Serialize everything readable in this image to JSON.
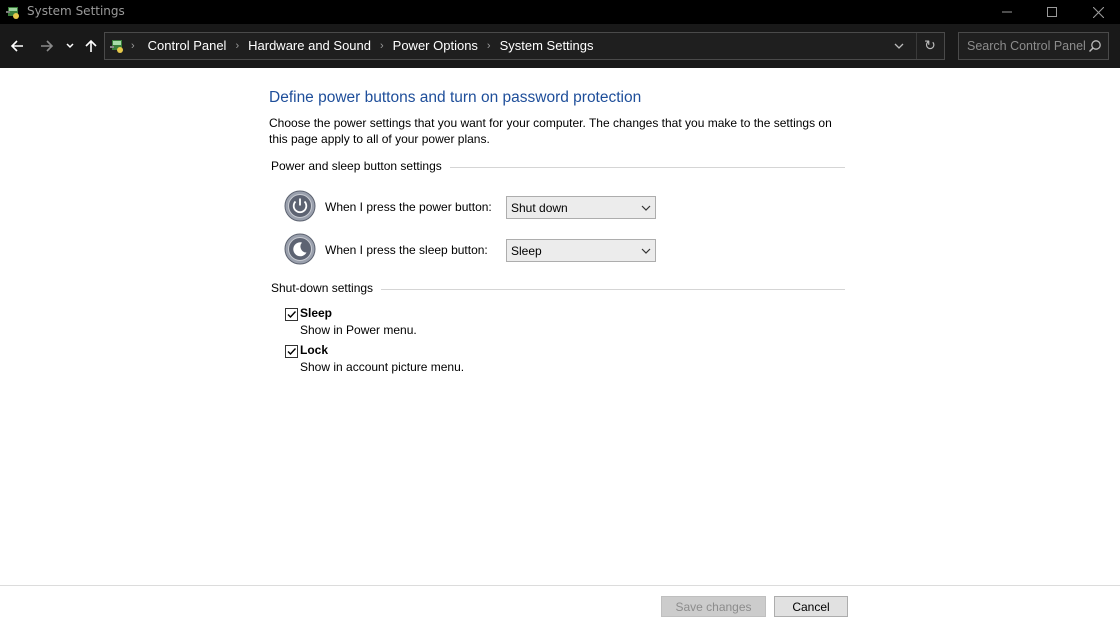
{
  "window": {
    "title": "System Settings",
    "controls": {
      "minimize": "minimize-icon",
      "maximize": "maximize-icon",
      "close": "close-icon"
    }
  },
  "nav": {
    "breadcrumbs": [
      "Control Panel",
      "Hardware and Sound",
      "Power Options",
      "System Settings"
    ],
    "search_placeholder": "Search Control Panel"
  },
  "content": {
    "heading": "Define power buttons and turn on password protection",
    "description": "Choose the power settings that you want for your computer. The changes that you make to the settings on this page apply to all of your power plans.",
    "power_section": {
      "title": "Power and sleep button settings",
      "power_button": {
        "label": "When I press the power button:",
        "value": "Shut down"
      },
      "sleep_button": {
        "label": "When I press the sleep button:",
        "value": "Sleep"
      }
    },
    "shutdown_section": {
      "title": "Shut-down settings",
      "options": [
        {
          "title": "Sleep",
          "description": "Show in Power menu.",
          "checked": true
        },
        {
          "title": "Lock",
          "description": "Show in account picture menu.",
          "checked": true
        }
      ]
    }
  },
  "footer": {
    "save_label": "Save changes",
    "cancel_label": "Cancel",
    "save_enabled": false
  },
  "colors": {
    "heading": "#1e4e9a",
    "titlebar": "#000000",
    "navbar": "#191919"
  }
}
